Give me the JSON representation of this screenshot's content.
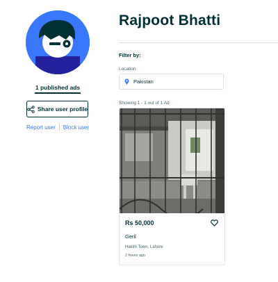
{
  "profile": {
    "name": "Rajpoot Bhatti",
    "published_ads": "1 published ads",
    "share_label": "Share user profile",
    "report_label": "Report user",
    "block_label": "Block user"
  },
  "filters": {
    "heading": "Filter by:",
    "location_label": "Location",
    "location_value": "Pakistan"
  },
  "results": {
    "showing": "Showing 1 - 1 out of 1 Ad"
  },
  "ads": [
    {
      "price": "Rs 50,000",
      "title": "Geril",
      "location": "Hakim Town, Lahore",
      "posted": "2 hours ago"
    }
  ],
  "icons": {
    "share": "share-icon",
    "location": "location-pin-icon",
    "favorite": "heart-icon"
  },
  "colors": {
    "primary_text": "#002f34",
    "link": "#3a77ff",
    "avatar_bg": "#3a77ff"
  }
}
